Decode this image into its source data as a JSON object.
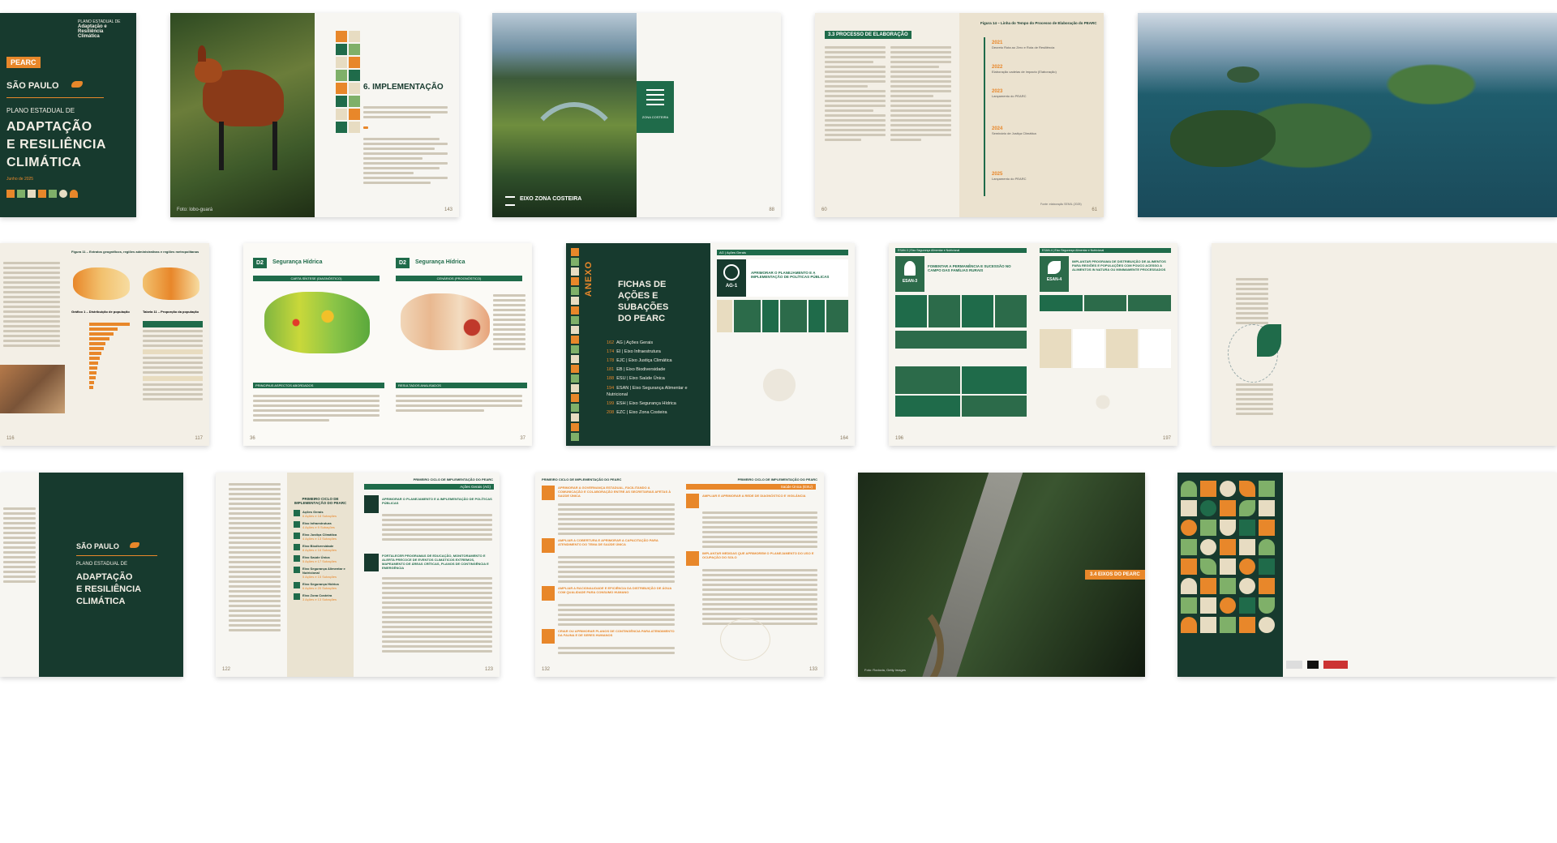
{
  "cover": {
    "badge": "PEARC",
    "state": "SÃO PAULO",
    "subtitle": "PLANO ESTADUAL DE",
    "title_lines": [
      "ADAPTAÇÃO",
      "E RESILIÊNCIA",
      "CLIMÁTICA"
    ],
    "date": "Junho de 2025",
    "logo_lines": [
      "PLANO ESTADUAL DE",
      "Adaptação e",
      "Resiliência",
      "Climática"
    ]
  },
  "spread2": {
    "section_title": "6. IMPLEMENTAÇÃO",
    "photo_credit": "Foto: lobo-guará",
    "page_num": "143"
  },
  "spread3": {
    "zone_label": "ZONA COSTEIRA",
    "eixo_title": "EIXO ZONA COSTEIRA",
    "page_num": "88"
  },
  "spread4": {
    "section": "3.3 PROCESSO DE ELABORAÇÃO",
    "figure_caption": "Figura 14 – Linha do Tempo do Processo de Elaboração do PEARC",
    "years": [
      "2021",
      "2022",
      "2023",
      "2024",
      "2025"
    ],
    "year_notes": [
      "Decreto Rota ao Zero e Rota de Resiliência",
      "Elaboração cadeias de impacto (Elaboração)",
      "Lançamento do PEARC",
      "Seminário de Justiça Climática",
      "Lançamento do PEARC"
    ],
    "source": "Fonte: elaboração SEMIL (2025)",
    "pages": [
      "60",
      "61"
    ]
  },
  "spread6": {
    "figure": "Figura 11 – Extratos geográficos, regiões administrativas e regiões metropolitanas",
    "chart_title": "Gráfico 1 – Distribuição de população",
    "table_title": "Tabela 11 – Proporção da população",
    "pages": [
      "116",
      "117"
    ]
  },
  "spread7": {
    "code": "D2",
    "title": "Segurança Hídrica",
    "left_map": "CARTA SÍNTESE (DIAGNÓSTICO)",
    "right_map": "CENÁRIOS (PROGNÓSTICO)",
    "left_heading": "PRINCIPAIS ASPECTOS ABORDADOS",
    "right_heading": "RESULTADOS ANALISADOS",
    "pages": [
      "36",
      "37"
    ]
  },
  "spread8": {
    "anexo": "ANEXO",
    "title_lines": [
      "FICHAS DE",
      "AÇÕES E",
      "SUBAÇÕES",
      "DO PEARC"
    ],
    "toc": [
      {
        "n": "162",
        "t": "AG | Ações Gerais"
      },
      {
        "n": "174",
        "t": "EI | Eixo Infraestrutura"
      },
      {
        "n": "178",
        "t": "EJC | Eixo Justiça Climática"
      },
      {
        "n": "181",
        "t": "EB | Eixo Biodiversidade"
      },
      {
        "n": "188",
        "t": "ESU | Eixo Saúde Única"
      },
      {
        "n": "194",
        "t": "ESAN | Eixo Segurança Alimentar e Nutricional"
      },
      {
        "n": "199",
        "t": "ESH | Eixo Segurança Hídrica"
      },
      {
        "n": "208",
        "t": "EZC | Eixo Zona Costeira"
      }
    ],
    "right_header": "AG | Ações Gerais",
    "ag_code": "AG-1",
    "ag_text": "APRIMORAR O PLANEJAMENTO E A IMPLEMENTAÇÃO DE POLÍTICAS PÚBLICAS",
    "page_num": "164"
  },
  "spread9": {
    "left_header": "ESAN-3 | Eixo Segurança Alimentar e Nutricional",
    "left_code": "ESAN-3",
    "left_title": "FOMENTAR A PERMANÊNCIA E SUCESSÃO NO CAMPO DAS FAMÍLIAS RURAIS",
    "right_header": "ESAN-4 | Eixo Segurança Alimentar e Nutricional",
    "right_code": "ESAN-4",
    "right_title": "IMPLANTAR PROGRAMA DE DISTRIBUIÇÃO DE ALIMENTOS PARA REGIÕES E POPULAÇÕES COM POUCO ACESSO A ALIMENTOS IN NATURA OU MINIMAMENTE PROCESSADOS",
    "pages": [
      "196",
      "197"
    ]
  },
  "spread11": {
    "state": "SÃO PAULO",
    "subtitle": "PLANO ESTADUAL DE",
    "title_lines": [
      "ADAPTAÇÃO",
      "E RESILIÊNCIA",
      "CLIMÁTICA"
    ]
  },
  "spread12": {
    "header": "PRIMEIRO CICLO DE IMPLEMENTAÇÃO DO PEARC",
    "left_title": "PRIMEIRO CICLO DE IMPLEMENTAÇÃO DO PEARC",
    "section": "Ações Gerais (AG)",
    "ag1": "APRIMORAR O PLANEJAMENTO E A IMPLEMENTAÇÃO DE POLÍTICAS PÚBLICAS",
    "ag2": "FORTALECER PROGRAMAS DE EDUCAÇÃO, MONITORAMENTO E ALERTA PRECOCE DE EVENTOS CLIMÁTICOS EXTREMOS, MAPEAMENTO DE ÁREAS CRÍTICAS, PLANOS DE CONTINGÊNCIA E EMERGÊNCIA",
    "list": [
      {
        "t": "Ações Gerais",
        "s": "6 Ações e 18 Subações"
      },
      {
        "t": "Eixo Infraestrutura",
        "s": "4 Ações e 9 Subações"
      },
      {
        "t": "Eixo Justiça Climática",
        "s": "4 Ações e 13 Subações"
      },
      {
        "t": "Eixo Biodiversidade",
        "s": "8 Ações e 16 Subações"
      },
      {
        "t": "Eixo Saúde Única",
        "s": "5 Ações e 17 Subações"
      },
      {
        "t": "Eixo Segurança Alimentar e Nutricional",
        "s": "5 Ações e 15 Subações"
      },
      {
        "t": "Eixo Segurança Hídrica",
        "s": "6 Ações e 20 Subações"
      },
      {
        "t": "Eixo Zona Costeira",
        "s": "3 Ações e 13 Subações"
      }
    ],
    "pages": [
      "122",
      "123"
    ]
  },
  "spread13": {
    "header": "PRIMEIRO CICLO DE IMPLEMENTAÇÃO DO PEARC",
    "section": "Saúde Única (ESU)",
    "items": [
      "APRIMORAR A GOVERNANÇA ESTADUAL, FACILITANDO A COMUNICAÇÃO E COLABORAÇÃO ENTRE AS SECRETARIAS AFETAS À SAÚDE ÚNICA",
      "AMPLIAR A COBERTURA E APRIMORAR A CAPACITAÇÃO PARA ATENDIMENTO DO TEMA DE SAÚDE ÚNICA",
      "AMPLIAR A RACIONALIDADE E EFICIÊNCIA DA DISTRIBUIÇÃO DE ÁGUA COM QUALIDADE PARA CONSUMO HUMANO",
      "CRIAR OU APRIMORAR PLANOS DE CONTINGÊNCIA PARA ATENDIMENTO DA FAUNA E DE SERES HUMANOS"
    ],
    "right_items": [
      "AMPLIAR E APRIMORAR A REDE DE DIAGNÓSTICO E VIGILÂNCIA",
      "IMPLANTAR MEDIDAS QUE APRIMOREM O PLANEJAMENTO DO USO E OCUPAÇÃO DO SOLO"
    ],
    "pages": [
      "132",
      "133"
    ]
  },
  "spread14": {
    "tag": "3.4 EIXOS DO PEARC",
    "credit": "Foto: Rodovia, Getty Images"
  }
}
